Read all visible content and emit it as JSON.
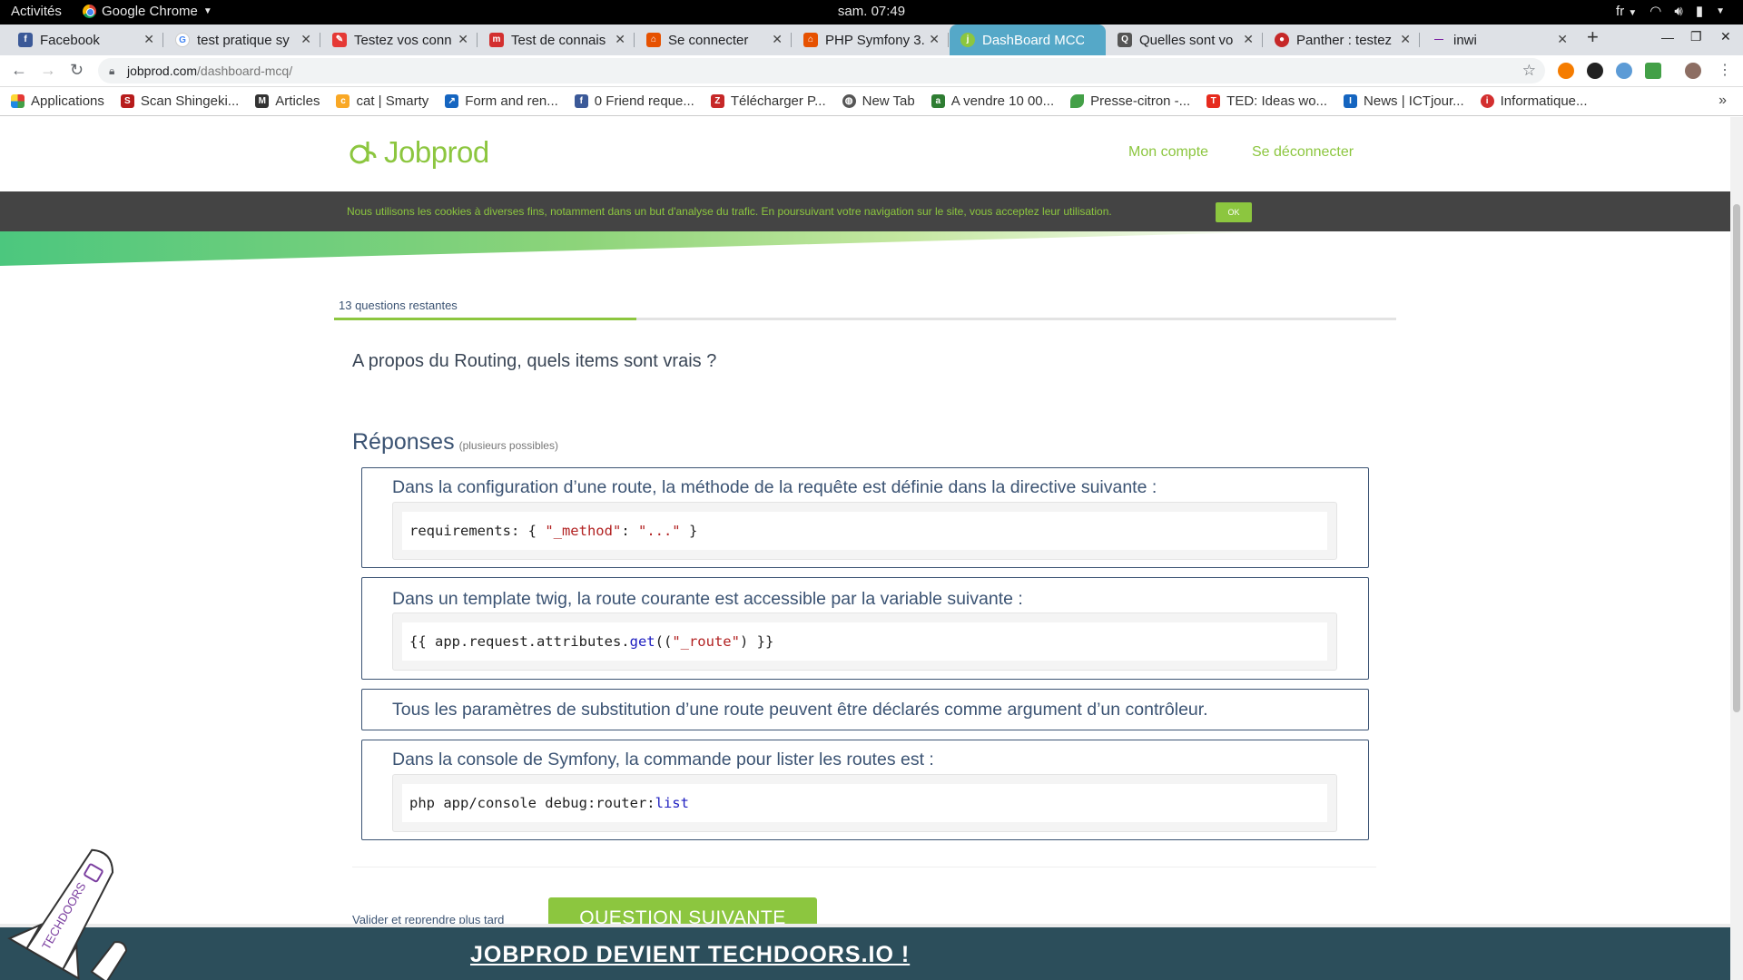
{
  "os": {
    "activities": "Activités",
    "app_name": "Google Chrome",
    "clock": "sam. 07:49",
    "lang": "fr"
  },
  "tabs": [
    {
      "title": "Facebook",
      "favicon": "f",
      "color": "#3b5998"
    },
    {
      "title": "test pratique sy",
      "favicon": "G",
      "color": "#ffffff"
    },
    {
      "title": "Testez vos conn",
      "favicon": "",
      "color": "#e53935"
    },
    {
      "title": "Test de connais",
      "favicon": "",
      "color": "#d32f2f"
    },
    {
      "title": "Se connecter",
      "favicon": "",
      "color": "#e65100"
    },
    {
      "title": "PHP Symfony 3.",
      "favicon": "",
      "color": "#e65100"
    },
    {
      "title": "DashBoard MCC",
      "favicon": "",
      "color": "#8cc63f"
    },
    {
      "title": "Quelles sont vo",
      "favicon": "",
      "color": "#555555"
    },
    {
      "title": "Panther : testez",
      "favicon": "",
      "color": "#c62828"
    },
    {
      "title": "inwi",
      "favicon": "",
      "color": "#7b1fa2"
    }
  ],
  "address": {
    "domain": "jobprod.com",
    "path": "/dashboard-mcq/"
  },
  "bookmarks": [
    {
      "label": "Applications",
      "color": "#e53935"
    },
    {
      "label": "Scan Shingeki...",
      "color": "#b71c1c"
    },
    {
      "label": "Articles",
      "color": "#333333"
    },
    {
      "label": "cat | Smarty",
      "color": "#f9a825"
    },
    {
      "label": "Form and ren...",
      "color": "#1565c0"
    },
    {
      "label": "0 Friend reque...",
      "color": "#3b5998"
    },
    {
      "label": "Télécharger P...",
      "color": "#c62828"
    },
    {
      "label": "New Tab",
      "color": "#555555"
    },
    {
      "label": "A vendre 10 00...",
      "color": "#2e7d32"
    },
    {
      "label": "Presse-citron -...",
      "color": "#43a047"
    },
    {
      "label": "TED: Ideas wo...",
      "color": "#e62b1e"
    },
    {
      "label": "News | ICTjour...",
      "color": "#1565c0"
    },
    {
      "label": "Informatique...",
      "color": "#d32f2f"
    }
  ],
  "site": {
    "logo_text": "Jobprod",
    "nav_account": "Mon compte",
    "nav_logout": "Se déconnecter",
    "brand_color": "#8cc63f",
    "dark_blue": "#3b5373"
  },
  "cookie": {
    "text": "Nous utilisons les cookies à diverses fins, notamment dans un but d'analyse du trafic. En poursuivant votre navigation sur le site, vous acceptez leur utilisation.",
    "ok": "OK"
  },
  "quiz": {
    "remaining_label": "13 questions restantes",
    "progress_fraction": 0.285,
    "question": "A propos du Routing, quels items sont vrais ?",
    "answers_title": "Réponses",
    "answers_hint": "(plusieurs possibles)",
    "answers": [
      {
        "text": "Dans la configuration d’une route, la méthode de la requête est définie dans la directive suivante :"
      },
      {
        "text": "Dans un template twig, la route courante est accessible par la variable suivante :"
      },
      {
        "text": "Tous les paramètres de substitution d’une route peuvent être déclarés comme argument d’un contrôleur."
      },
      {
        "text": "Dans la console de Symfony, la commande pour lister les routes est :"
      }
    ],
    "code": {
      "a1_prefix": "requirements: { ",
      "a1_key": "\"_method\"",
      "a1_colon": ": ",
      "a1_val": "\"...\"",
      "a1_suffix": " }",
      "a2_prefix": "{{ app.request.attributes.",
      "a2_fn": "get",
      "a2_open": "((",
      "a2_str": "\"_route\"",
      "a2_suffix": ") }}",
      "a4_prefix": "php app/console debug:router:",
      "a4_kw": "list"
    },
    "validate_label": "Valider et reprendre plus tard",
    "next_label": "QUESTION SUIVANTE"
  },
  "banner": {
    "text": "JOBPROD DEVIENT TECHDOORS.IO !",
    "rocket_text": "TECHDOORS"
  }
}
